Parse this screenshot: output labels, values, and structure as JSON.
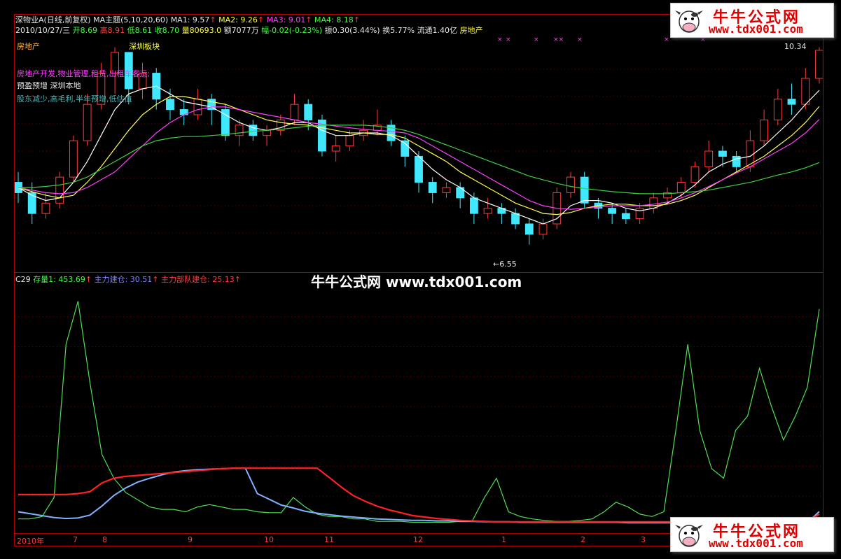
{
  "header": {
    "line1": {
      "stock": "深物业A(日线,前复权)",
      "ma_title": "MA主题(5,10,20,60)",
      "ma1": "MA1: 9.57",
      "ma2": "MA2: 9.26",
      "ma3": "MA3: 9.01",
      "ma4": "MA4: 8.18"
    },
    "line2": {
      "date": "2010/10/27/三",
      "open": "开8.69",
      "high": "高8.91",
      "low": "低8.61",
      "close": "收8.70",
      "volume": "量80693.0",
      "amount": "额7077万",
      "change": "幅-0.02(-0.23%)",
      "amplitude": "振0.30(3.44%)",
      "turnover": "换5.77%",
      "float": "流通1.40亿",
      "sector": "房地产"
    }
  },
  "info_panel": {
    "industry": "房地产",
    "board": "深圳板块",
    "business": "房地产开发,物业管理,租赁,出租车客运;",
    "tags1": "预盈预增 深圳本地",
    "tags2": "股东减少,高毛利,半年预增,低估值"
  },
  "price_labels": {
    "high": "10.34",
    "low": "←6.55"
  },
  "indicator": {
    "name": "C29",
    "s1": "存量1: 453.69",
    "s2": "主力建仓: 30.51",
    "s3": "主力部队建仓: 25.13"
  },
  "watermark": "牛牛公式网 www.tdx001.com",
  "logo": {
    "cn": "牛牛公式网",
    "url": "www.tdx001.com"
  },
  "markers": [
    "×",
    "×",
    "×",
    "××",
    "×",
    "×",
    "×"
  ],
  "colors": {
    "up": "#ff3c3c",
    "down": "#40e8ff",
    "ma1": "#ffffff",
    "ma2": "#ffff50",
    "ma3": "#ff40ff",
    "ma4": "#40d040",
    "inv": "#50e050",
    "build": "#7fb3ff",
    "army": "#ff2020"
  },
  "chart_data": {
    "type": "line",
    "x_ticks": [
      "2010年",
      "7",
      "8",
      "9",
      "10",
      "11",
      "12",
      "1",
      "2",
      "3"
    ],
    "price": {
      "ylim": [
        6.3,
        10.5
      ],
      "candles": [
        [
          7.8,
          7.6,
          8.0,
          7.4
        ],
        [
          7.6,
          7.2,
          7.8,
          7.0
        ],
        [
          7.2,
          7.4,
          7.6,
          7.1
        ],
        [
          7.4,
          7.9,
          8.0,
          7.3
        ],
        [
          7.9,
          8.6,
          8.7,
          7.8
        ],
        [
          8.6,
          9.3,
          9.5,
          8.5
        ],
        [
          9.3,
          9.9,
          10.1,
          9.2
        ],
        [
          9.9,
          10.3,
          10.4,
          9.5
        ],
        [
          10.3,
          9.6,
          10.2,
          9.3
        ],
        [
          9.6,
          9.9,
          10.1,
          9.4
        ],
        [
          9.9,
          9.4,
          10.0,
          9.2
        ],
        [
          9.4,
          9.2,
          9.6,
          9.0
        ],
        [
          9.2,
          9.1,
          9.4,
          8.9
        ],
        [
          9.1,
          9.4,
          9.6,
          9.0
        ],
        [
          9.4,
          9.2,
          9.5,
          8.9
        ],
        [
          9.2,
          8.7,
          9.3,
          8.6
        ],
        [
          8.7,
          8.9,
          9.0,
          8.5
        ],
        [
          8.9,
          8.7,
          9.0,
          8.6
        ],
        [
          8.7,
          8.8,
          8.9,
          8.5
        ],
        [
          8.8,
          9.0,
          9.1,
          8.7
        ],
        [
          9.0,
          9.3,
          9.5,
          8.9
        ],
        [
          9.3,
          9.0,
          9.4,
          8.8
        ],
        [
          9.0,
          8.4,
          9.1,
          8.3
        ],
        [
          8.4,
          8.5,
          8.7,
          8.2
        ],
        [
          8.5,
          8.7,
          8.8,
          8.4
        ],
        [
          8.7,
          8.8,
          9.0,
          8.6
        ],
        [
          8.8,
          8.9,
          9.2,
          8.7
        ],
        [
          8.9,
          8.6,
          9.0,
          8.5
        ],
        [
          8.6,
          8.3,
          8.7,
          8.1
        ],
        [
          8.3,
          7.8,
          8.4,
          7.6
        ],
        [
          7.8,
          7.6,
          7.9,
          7.4
        ],
        [
          7.6,
          7.7,
          7.8,
          7.5
        ],
        [
          7.7,
          7.5,
          7.8,
          7.3
        ],
        [
          7.5,
          7.2,
          7.6,
          7.0
        ],
        [
          7.2,
          7.3,
          7.5,
          7.1
        ],
        [
          7.3,
          7.2,
          7.4,
          7.0
        ],
        [
          7.2,
          7.0,
          7.3,
          6.9
        ],
        [
          7.0,
          6.8,
          7.1,
          6.6
        ],
        [
          6.8,
          7.0,
          7.1,
          6.7
        ],
        [
          7.0,
          7.6,
          7.7,
          6.9
        ],
        [
          7.6,
          7.9,
          8.0,
          7.5
        ],
        [
          7.9,
          7.4,
          8.0,
          7.3
        ],
        [
          7.4,
          7.3,
          7.5,
          7.1
        ],
        [
          7.3,
          7.2,
          7.4,
          7.0
        ],
        [
          7.2,
          7.1,
          7.3,
          7.0
        ],
        [
          7.1,
          7.3,
          7.4,
          7.0
        ],
        [
          7.3,
          7.5,
          7.6,
          7.2
        ],
        [
          7.5,
          7.6,
          7.7,
          7.4
        ],
        [
          7.6,
          7.8,
          7.9,
          7.5
        ],
        [
          7.8,
          8.1,
          8.2,
          7.7
        ],
        [
          8.1,
          8.4,
          8.6,
          8.0
        ],
        [
          8.4,
          8.3,
          8.5,
          8.1
        ],
        [
          8.3,
          8.1,
          8.4,
          8.0
        ],
        [
          8.1,
          8.6,
          8.8,
          8.0
        ],
        [
          8.6,
          9.0,
          9.2,
          8.5
        ],
        [
          9.0,
          9.4,
          9.6,
          8.9
        ],
        [
          9.4,
          9.3,
          9.7,
          9.1
        ],
        [
          9.3,
          9.8,
          10.0,
          9.2
        ],
        [
          9.8,
          10.34,
          10.4,
          9.7
        ]
      ],
      "ma1": [
        7.7,
        7.55,
        7.45,
        7.5,
        7.8,
        8.2,
        8.7,
        9.2,
        9.5,
        9.6,
        9.65,
        9.5,
        9.35,
        9.3,
        9.25,
        9.1,
        8.95,
        8.85,
        8.8,
        8.85,
        8.95,
        8.95,
        8.8,
        8.7,
        8.7,
        8.75,
        8.75,
        8.7,
        8.55,
        8.3,
        8.05,
        7.85,
        7.7,
        7.5,
        7.4,
        7.3,
        7.2,
        7.1,
        7.0,
        7.1,
        7.35,
        7.45,
        7.45,
        7.4,
        7.3,
        7.25,
        7.3,
        7.4,
        7.55,
        7.75,
        8.0,
        8.15,
        8.25,
        8.3,
        8.5,
        8.75,
        9.0,
        9.3,
        9.57
      ],
      "ma2": [
        7.7,
        7.62,
        7.55,
        7.5,
        7.55,
        7.8,
        8.1,
        8.45,
        8.8,
        9.1,
        9.3,
        9.45,
        9.45,
        9.4,
        9.35,
        9.3,
        9.2,
        9.1,
        9.0,
        8.95,
        8.92,
        8.9,
        8.85,
        8.8,
        8.75,
        8.75,
        8.72,
        8.72,
        8.65,
        8.5,
        8.35,
        8.2,
        8.0,
        7.85,
        7.7,
        7.55,
        7.4,
        7.3,
        7.2,
        7.18,
        7.22,
        7.3,
        7.35,
        7.38,
        7.38,
        7.35,
        7.35,
        7.38,
        7.45,
        7.55,
        7.7,
        7.85,
        8.0,
        8.15,
        8.3,
        8.5,
        8.7,
        8.95,
        9.26
      ],
      "ma3": [
        7.7,
        7.65,
        7.6,
        7.58,
        7.6,
        7.7,
        7.85,
        8.0,
        8.25,
        8.5,
        8.75,
        8.95,
        9.1,
        9.2,
        9.25,
        9.25,
        9.2,
        9.15,
        9.1,
        9.05,
        9.0,
        8.95,
        8.92,
        8.88,
        8.85,
        8.82,
        8.8,
        8.78,
        8.75,
        8.65,
        8.5,
        8.35,
        8.2,
        8.05,
        7.9,
        7.75,
        7.6,
        7.45,
        7.35,
        7.3,
        7.28,
        7.3,
        7.32,
        7.35,
        7.35,
        7.35,
        7.38,
        7.42,
        7.5,
        7.6,
        7.72,
        7.85,
        7.98,
        8.1,
        8.25,
        8.4,
        8.55,
        8.75,
        9.01
      ],
      "ma4": [
        7.7,
        7.7,
        7.72,
        7.75,
        7.8,
        7.9,
        8.05,
        8.2,
        8.35,
        8.5,
        8.6,
        8.65,
        8.68,
        8.68,
        8.7,
        8.72,
        8.75,
        8.78,
        8.8,
        8.82,
        8.85,
        8.88,
        8.9,
        8.9,
        8.9,
        8.9,
        8.88,
        8.85,
        8.8,
        8.72,
        8.62,
        8.52,
        8.42,
        8.32,
        8.22,
        8.12,
        8.02,
        7.92,
        7.85,
        7.78,
        7.72,
        7.68,
        7.65,
        7.62,
        7.6,
        7.58,
        7.58,
        7.58,
        7.6,
        7.62,
        7.65,
        7.7,
        7.75,
        7.8,
        7.87,
        7.94,
        8.0,
        8.08,
        8.18
      ]
    },
    "indicator": {
      "ylim": [
        0,
        500
      ],
      "series": [
        {
          "name": "存量1",
          "values": [
            15,
            15,
            20,
            60,
            380,
            470,
            300,
            150,
            100,
            70,
            55,
            40,
            35,
            35,
            30,
            40,
            45,
            40,
            35,
            35,
            30,
            28,
            28,
            60,
            40,
            25,
            20,
            20,
            15,
            15,
            10,
            10,
            10,
            8,
            8,
            8,
            8,
            10,
            12,
            60,
            100,
            30,
            20,
            15,
            12,
            10,
            10,
            12,
            15,
            30,
            50,
            40,
            25,
            20,
            30,
            200,
            380,
            200,
            120,
            100,
            200,
            230,
            330,
            250,
            180,
            230,
            290,
            453.69
          ]
        },
        {
          "name": "主力建仓",
          "values": [
            30,
            26,
            22,
            18,
            16,
            17,
            23,
            42,
            64,
            80,
            92,
            100,
            107,
            113,
            116,
            118,
            119,
            120,
            121,
            121,
            68,
            56,
            44,
            38,
            31,
            27,
            24,
            21,
            19,
            17,
            15,
            14,
            13,
            12,
            12,
            11,
            11,
            10,
            10,
            9,
            9,
            9,
            8,
            8,
            8,
            8,
            8,
            8,
            8,
            8,
            8,
            7,
            7,
            7,
            7,
            7,
            7,
            7,
            7,
            7,
            7,
            7,
            7,
            7,
            7,
            7,
            7,
            30.51
          ]
        },
        {
          "name": "主力部队建仓",
          "values": [
            66,
            66,
            66,
            66,
            66,
            68,
            72,
            90,
            100,
            104,
            106,
            108,
            110,
            112,
            114,
            116,
            118,
            120,
            121,
            121,
            121,
            121,
            121,
            121,
            121,
            121,
            102,
            82,
            64,
            52,
            42,
            34,
            28,
            22,
            19,
            16,
            14,
            12,
            11,
            10,
            9,
            9,
            9,
            9,
            9,
            9,
            9,
            9,
            9,
            9,
            9,
            9,
            9,
            9,
            9,
            9,
            9,
            9,
            9,
            9,
            9,
            9,
            9,
            9,
            9,
            9,
            9,
            25.13
          ]
        }
      ]
    }
  }
}
